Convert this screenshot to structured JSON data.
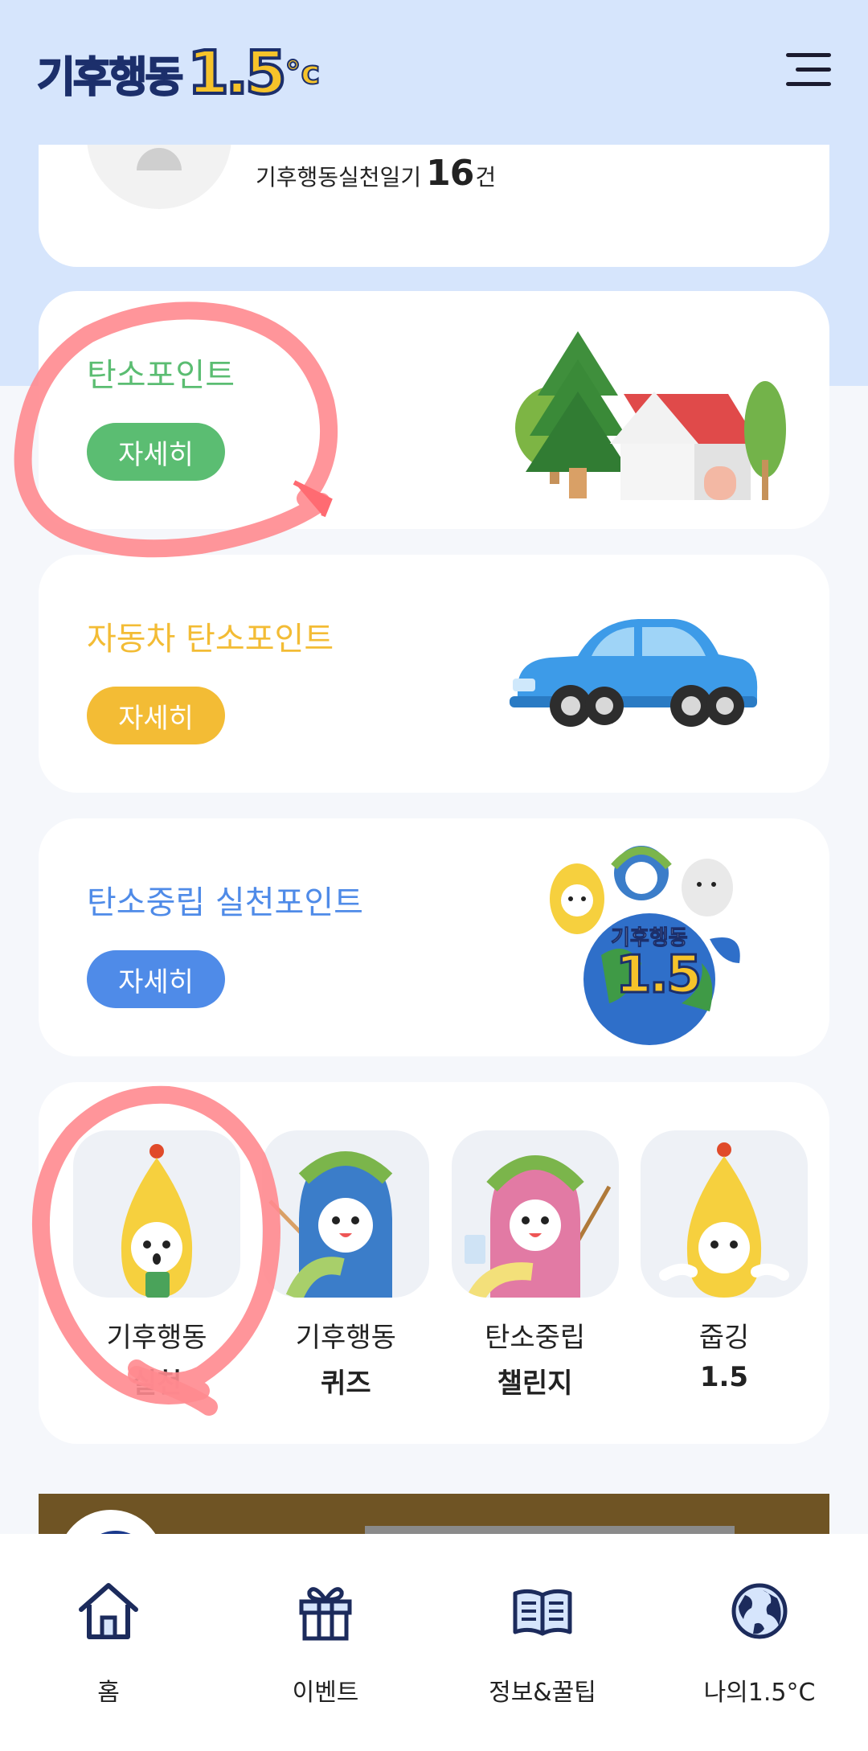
{
  "header": {
    "logo_text": "기후행동",
    "logo_number": "1.5",
    "logo_unit": "°c"
  },
  "profile": {
    "diary_label": "기후행동실천일기",
    "diary_count": "16",
    "diary_unit": "건"
  },
  "point_cards": [
    {
      "title": "탄소포인트",
      "button": "자세히",
      "color": "#5bbd72",
      "illustration": "house-trees"
    },
    {
      "title": "자동차 탄소포인트",
      "button": "자세히",
      "color": "#f3bc35",
      "illustration": "blue-car"
    },
    {
      "title": "탄소중립 실천포인트",
      "button": "자세히",
      "color": "#4f8be8",
      "illustration": "mascots-globe"
    }
  ],
  "globe_badge": {
    "top": "기후행동",
    "number": "1.5"
  },
  "menu": [
    {
      "line1": "기후행동",
      "line2": "실천",
      "icon": "yellow-mascot-with-checklist"
    },
    {
      "line1": "기후행동",
      "line2": "퀴즈",
      "icon": "blue-mascot-with-pointer"
    },
    {
      "line1": "탄소중립",
      "line2": "챌린지",
      "icon": "pink-mascot-with-pointer"
    },
    {
      "line1": "줍깅",
      "line2": "1.5",
      "icon": "yellow-mascot-waving"
    }
  ],
  "bottom_nav": [
    {
      "label": "홈",
      "icon": "home-icon"
    },
    {
      "label": "이벤트",
      "icon": "gift-icon"
    },
    {
      "label": "정보&꿀팁",
      "icon": "book-icon"
    },
    {
      "label": "나의1.5°C",
      "icon": "globe-icon"
    }
  ],
  "colors": {
    "top_band": "#d6e5fc",
    "background": "#f5f7fb",
    "annotation": "#ff8a8f",
    "nav_icon": "#1c2b5c"
  }
}
